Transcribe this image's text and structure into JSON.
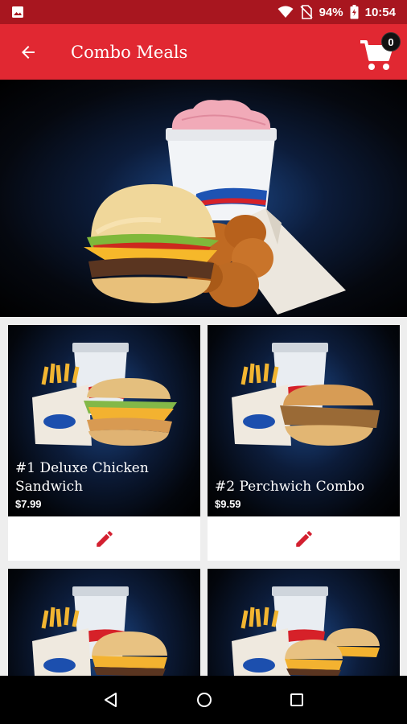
{
  "status_bar": {
    "battery": "94%",
    "time": "10:54"
  },
  "app_bar": {
    "title": "Combo Meals",
    "cart_count": "0"
  },
  "products": [
    {
      "name": "#1 Deluxe Chicken Sandwich",
      "price": "$7.99"
    },
    {
      "name": "#2 Perchwich Combo",
      "price": "$9.59"
    },
    {
      "name": "",
      "price": ""
    },
    {
      "name": "",
      "price": ""
    }
  ],
  "colors": {
    "primary": "#e12832",
    "status_bar": "#a8161f",
    "accent_icon": "#d32030"
  },
  "icons": [
    "image-icon",
    "wifi-icon",
    "no-sim-icon",
    "battery-icon",
    "back-arrow-icon",
    "cart-icon",
    "edit-pencil-icon",
    "nav-back-icon",
    "nav-home-icon",
    "nav-recents-icon"
  ]
}
